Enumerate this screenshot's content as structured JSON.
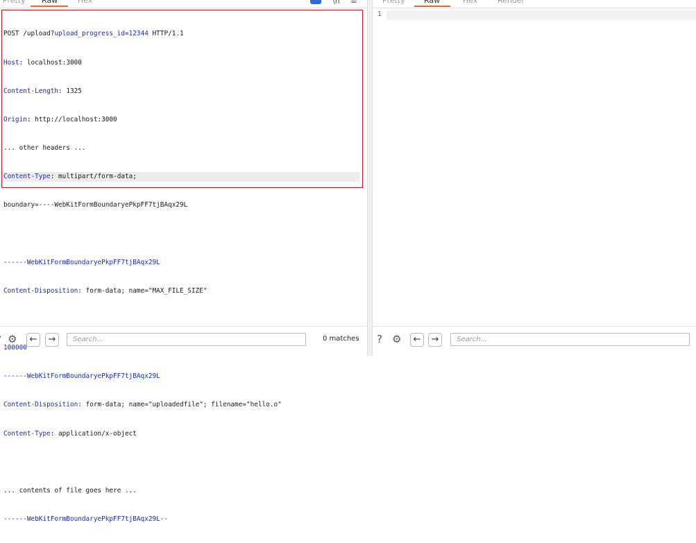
{
  "left": {
    "tabs": [
      "Pretty",
      "Raw",
      "Hex"
    ],
    "active_tab": "Raw",
    "request": {
      "line1": {
        "method_path": "POST /upload?",
        "param_name": "upload_progress_id",
        "eq": "=",
        "param_value": "12344",
        "proto": " HTTP/1.1"
      },
      "headers": [
        {
          "name": "Host",
          "value": " localhost:3000"
        },
        {
          "name": "Content-Length",
          "value": " 1325"
        },
        {
          "name": "Origin",
          "value": " http://localhost:3000"
        }
      ],
      "other_headers": "... other headers ...",
      "content_type": {
        "name": "Content-Type",
        "value": " multipart/form-data;"
      },
      "boundary_line": "boundary=----WebKitFormBoundaryePkpFF7tjBAqx29L",
      "boundary": "------WebKitFormBoundaryePkpFF7tjBAqx29L",
      "disp1": {
        "name": "Content-Disposition",
        "value": " form-data; name=\"MAX_FILE_SIZE\""
      },
      "value1": "100000",
      "disp2": {
        "name": "Content-Disposition",
        "value": " form-data; name=\"uploadedfile\"; filename=\"hello.o\""
      },
      "ctype2": {
        "name": "Content-Type",
        "value": " application/x-object"
      },
      "contents": "... contents of file goes here ...",
      "end_boundary": "------WebKitFormBoundaryePkpFF7tjBAqx29L--"
    },
    "footer": {
      "search_placeholder": "Search...",
      "matches": "0 matches"
    }
  },
  "right": {
    "tabs": [
      "Pretty",
      "Raw",
      "Hex",
      "Render"
    ],
    "active_tab": "Raw",
    "line_number": "1",
    "footer": {
      "search_placeholder": "Search..."
    }
  },
  "colors": {
    "accent": "#e8662b",
    "highlight_border": "#c0182d",
    "header_key": "#1a2ea8"
  }
}
